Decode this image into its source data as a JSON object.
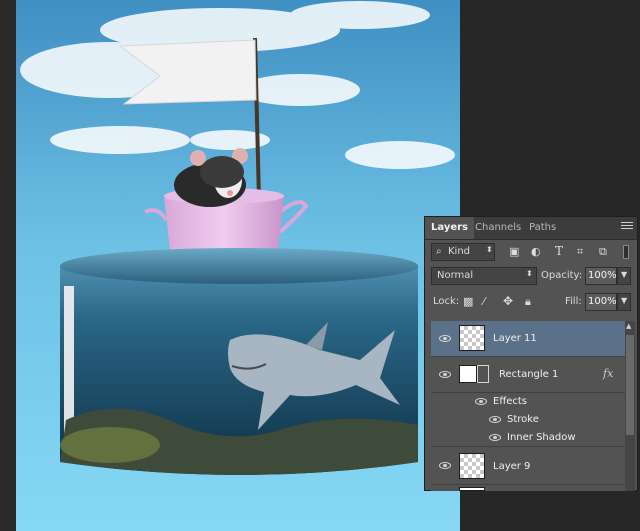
{
  "colors": {
    "panel_bg": "#535353",
    "selected_layer": "#5b7189",
    "tab_bar": "#3c3c3c",
    "water": "#1d4a66"
  },
  "tabs": [
    {
      "label": "Layers",
      "active": true
    },
    {
      "label": "Channels",
      "active": false
    },
    {
      "label": "Paths",
      "active": false
    }
  ],
  "filter": {
    "kind_label": "Kind"
  },
  "blend": {
    "mode": "Normal",
    "opacity_label": "Opacity:",
    "opacity_value": "100%"
  },
  "lock": {
    "label": "Lock:",
    "fill_label": "Fill:",
    "fill_value": "100%"
  },
  "layers": [
    {
      "name": "Layer 11",
      "selected": true,
      "visible": true
    },
    {
      "name": "Rectangle 1",
      "selected": false,
      "visible": true,
      "fx": "fx"
    },
    {
      "name": "Effects",
      "is_effect_header": true
    },
    {
      "name": "Stroke",
      "is_effect": true
    },
    {
      "name": "Inner Shadow",
      "is_effect": true
    },
    {
      "name": "Layer 9",
      "selected": false,
      "visible": true
    }
  ]
}
